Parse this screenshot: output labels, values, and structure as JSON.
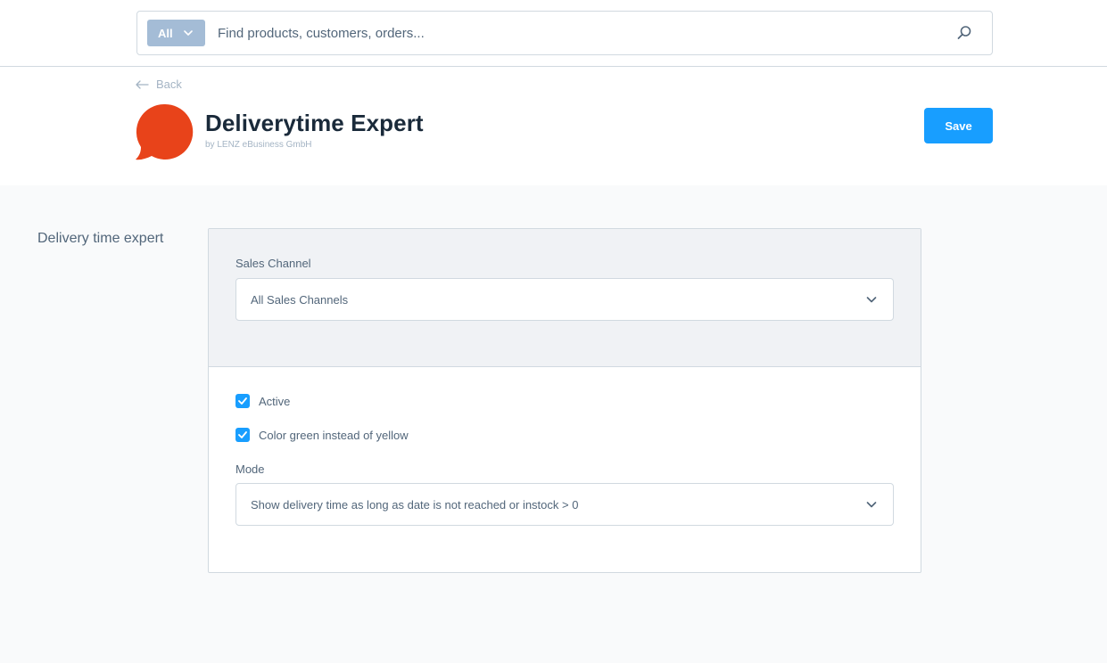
{
  "search": {
    "type_label": "All",
    "placeholder": "Find products, customers, orders..."
  },
  "header": {
    "back_label": "Back",
    "title": "Deliverytime Expert",
    "subtitle": "by LENZ eBusiness GmbH",
    "save_label": "Save",
    "logo_color": "#e8431a"
  },
  "settings": {
    "section_title": "Delivery time expert",
    "sales_channel_label": "Sales Channel",
    "sales_channel_value": "All Sales Channels",
    "active_label": "Active",
    "active_checked": true,
    "color_green_label": "Color green instead of yellow",
    "color_green_checked": true,
    "mode_label": "Mode",
    "mode_value": "Show delivery time as long as date is not reached or instock > 0"
  },
  "colors": {
    "accent": "#189eff",
    "text": "#52667a",
    "border": "#d1d9e0"
  }
}
